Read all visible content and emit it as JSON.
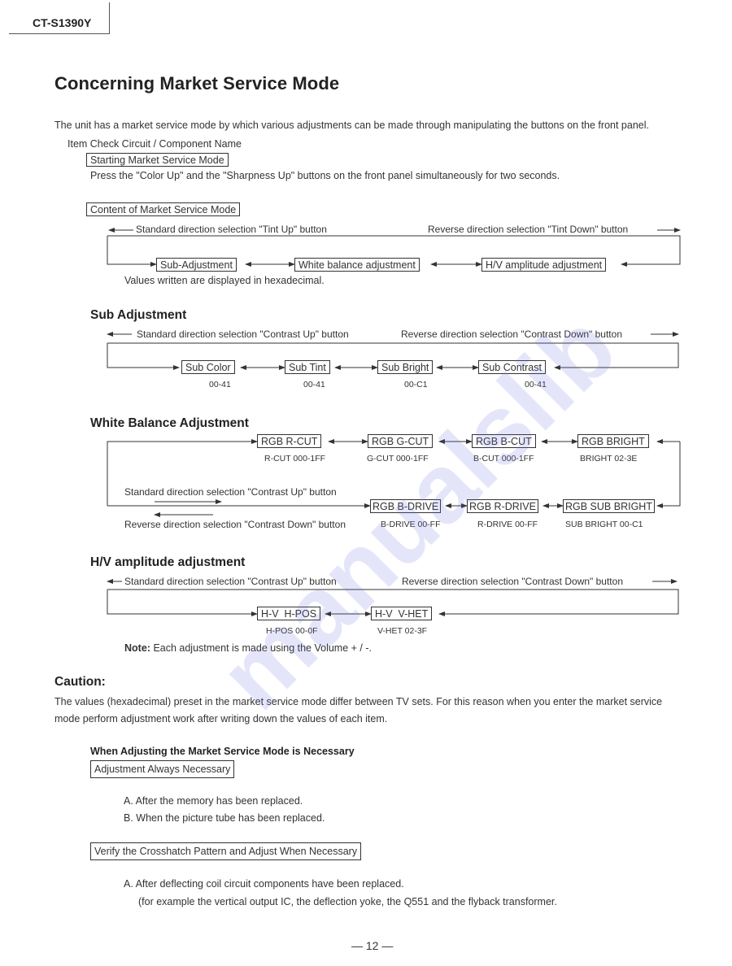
{
  "header": {
    "model": "CT-S1390Y"
  },
  "title": "Concerning Market Service Mode",
  "intro": "The unit has a market service mode by which various adjustments can be made through manipulating the buttons on the front panel.",
  "item_check": "Item Check Circuit / Component Name",
  "starting": {
    "box_label": "Starting Market Service Mode",
    "text": "Press the \"Color Up\" and the \"Sharpness Up\" buttons on the front panel simultaneously for two seconds."
  },
  "content": {
    "box_label": "Content of Market Service Mode",
    "standard_dir": "Standard direction selection \"Tint Up\" button",
    "reverse_dir": "Reverse direction selection \"Tint Down\" button",
    "nodes": [
      "Sub-Adjustment",
      "White balance adjustment",
      "H/V amplitude adjustment"
    ],
    "note": "Values written are displayed in hexadecimal."
  },
  "sub_adjustment": {
    "heading": "Sub Adjustment",
    "standard_dir": "Standard direction selection \"Contrast Up\" button",
    "reverse_dir": "Reverse direction selection \"Contrast Down\" button",
    "nodes": [
      {
        "label": "Sub Color",
        "range": "00-41"
      },
      {
        "label": "Sub Tint",
        "range": "00-41"
      },
      {
        "label": "Sub Bright",
        "range": "00-C1"
      },
      {
        "label": "Sub Contrast",
        "range": "00-41"
      }
    ]
  },
  "white_balance": {
    "heading": "White Balance Adjustment",
    "standard_dir": "Standard direction selection \"Contrast Up\" button",
    "reverse_dir": "Reverse direction selection \"Contrast Down\" button",
    "top_nodes": [
      {
        "label": "RGB R-CUT",
        "range": "R-CUT 000-1FF"
      },
      {
        "label": "RGB G-CUT",
        "range": "G-CUT 000-1FF"
      },
      {
        "label": "RGB B-CUT",
        "range": "B-CUT 000-1FF"
      },
      {
        "label": "RGB BRIGHT",
        "range": "BRIGHT 02-3E"
      }
    ],
    "bottom_nodes": [
      {
        "label": "RGB B-DRIVE",
        "range": "B-DRIVE 00-FF"
      },
      {
        "label": "RGB R-DRIVE",
        "range": "R-DRIVE 00-FF"
      },
      {
        "label": "RGB SUB BRIGHT",
        "range": "SUB BRIGHT 00-C1"
      }
    ]
  },
  "hv_amplitude": {
    "heading": "H/V amplitude adjustment",
    "standard_dir": "Standard direction selection \"Contrast Up\" button",
    "reverse_dir": "Reverse direction selection \"Contrast Down\" button",
    "nodes": [
      {
        "label": "H-V  H-POS",
        "range": "H-POS 00-0F"
      },
      {
        "label": "H-V  V-HET",
        "range": "V-HET 02-3F"
      }
    ],
    "note_label": "Note:",
    "note_text": "Each adjustment is made using the Volume + / -."
  },
  "caution": {
    "heading": "Caution:",
    "line1": "The values (hexadecimal) preset in the market service mode differ between TV sets.  For this reason when you enter the market service",
    "line2": "mode perform adjustment work after writing down the values of each item."
  },
  "when_adjusting": {
    "heading": "When Adjusting the Market Service Mode is Necessary",
    "always_box": "Adjustment Always Necessary",
    "always_items": [
      "A.  After the memory has been replaced.",
      "B.  When the picture tube has been replaced."
    ],
    "crosshatch_box": "Verify the Crosshatch Pattern and Adjust When Necessary",
    "crosshatch_items": [
      "A.  After deflecting coil circuit components have been replaced.",
      "(for example the vertical output IC, the deflection yoke, the Q551 and the flyback transformer."
    ]
  },
  "footer": {
    "page": "— 12 —"
  },
  "watermark": "manualslib"
}
